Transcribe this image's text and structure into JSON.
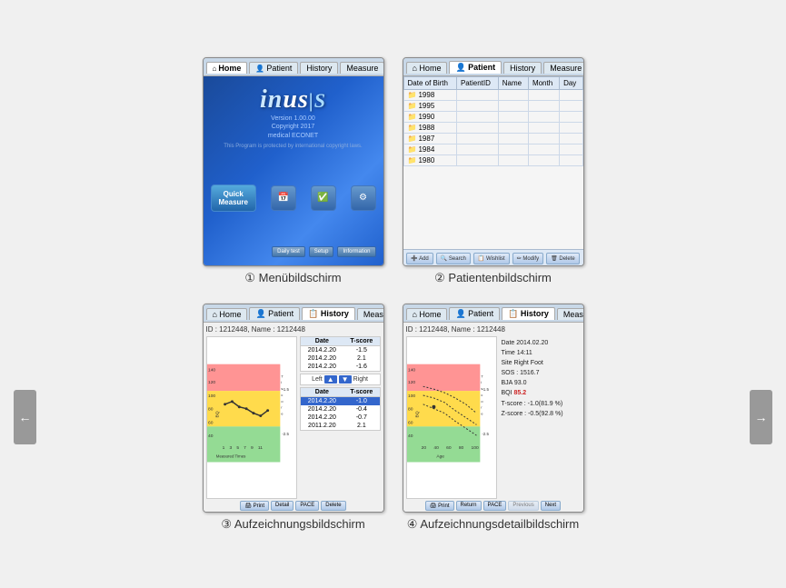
{
  "top_row": {
    "screen1": {
      "tabs": [
        {
          "label": "Home",
          "active": true,
          "icon": "⌂"
        },
        {
          "label": "Patient",
          "active": false,
          "icon": "👤"
        },
        {
          "label": "History",
          "active": false,
          "icon": "📋"
        },
        {
          "label": "Measure",
          "active": false,
          "icon": "📏"
        }
      ],
      "logo": "inus|S",
      "version": "Version 1.00.00",
      "copyright": "Copyright 2017\nmedical ECONET",
      "notice": "This Program is protected by international copyright laws.",
      "quick_measure": "Quick\nMeasure",
      "bottom_buttons": [
        "Daily test",
        "Setup",
        "Information"
      ],
      "caption_num": "①",
      "caption_text": "Menübildschirm"
    },
    "screen2": {
      "tabs": [
        {
          "label": "Home",
          "active": false,
          "icon": "⌂"
        },
        {
          "label": "Patient",
          "active": true,
          "icon": "👤"
        },
        {
          "label": "History",
          "active": false,
          "icon": "📋"
        },
        {
          "label": "Measure",
          "active": false,
          "icon": "📏"
        }
      ],
      "table_headers": [
        "Date of Birth",
        "PatientID",
        "Name",
        "Month",
        "Day"
      ],
      "folders": [
        "1998",
        "1995",
        "1990",
        "1988",
        "1987",
        "1984",
        "1980"
      ],
      "bottom_buttons": [
        "Add",
        "Search",
        "Wishlist",
        "Modify",
        "Delete"
      ],
      "caption_num": "②",
      "caption_text": "Patientenbildschirm"
    }
  },
  "bottom_row": {
    "arrow_left": "←",
    "arrow_right": "→",
    "screen3": {
      "tabs": [
        {
          "label": "Home",
          "active": false,
          "icon": "⌂"
        },
        {
          "label": "Patient",
          "active": false,
          "icon": "👤"
        },
        {
          "label": "History",
          "active": true,
          "icon": "📋"
        },
        {
          "label": "Measure",
          "active": false,
          "icon": "📏"
        }
      ],
      "id_label": "ID : 1212448, Name : 1212448",
      "chart_y_label": "B\nQ",
      "chart_y_values": [
        "140",
        "120",
        "100",
        "80",
        "60",
        "40"
      ],
      "chart_x_label": "Measured Times",
      "chart_x_values": [
        "1",
        "3",
        "5",
        "7",
        "9",
        "11"
      ],
      "t_label": "T\ni\ns\nc\no\nr\ne",
      "t_scale": [
        "-1.5",
        "-2.5"
      ],
      "table_top": {
        "headers": [
          "Date",
          "T-score"
        ],
        "rows": [
          {
            "date": "2014.2.20",
            "score": "-1.5"
          },
          {
            "date": "2014.2.20",
            "score": "2.1"
          },
          {
            "date": "2014.2.20",
            "score": "-1.6"
          }
        ]
      },
      "nav": {
        "left": "Left",
        "right": "Right"
      },
      "table_bottom": {
        "headers": [
          "Date",
          "T-score"
        ],
        "rows": [
          {
            "date": "2014.2.20",
            "score": "-1.0",
            "highlighted": true
          },
          {
            "date": "2014.2.20",
            "score": "-0.4"
          },
          {
            "date": "2014.2.20",
            "score": "-0.7"
          },
          {
            "date": "2011.2.20",
            "score": "2.1"
          }
        ]
      },
      "bottom_buttons": [
        "Print",
        "Detail",
        "PACE",
        "Delete"
      ],
      "caption_num": "③",
      "caption_text": "Aufzeichnungsbildschirm"
    },
    "screen4": {
      "tabs": [
        {
          "label": "Home",
          "active": false,
          "icon": "⌂"
        },
        {
          "label": "Patient",
          "active": false,
          "icon": "👤"
        },
        {
          "label": "History",
          "active": true,
          "icon": "📋"
        },
        {
          "label": "Measure",
          "active": false,
          "icon": "📏"
        }
      ],
      "id_label": "ID : 1212448, Name : 1212448",
      "chart_x_label": "Age",
      "chart_x_values": [
        "20",
        "40",
        "60",
        "80",
        "100"
      ],
      "chart_y_values": [
        "140",
        "120",
        "100",
        "80",
        "60",
        "40"
      ],
      "detail_info": {
        "date": "Date  2014.02.20",
        "time": "Time  14:11",
        "site": "Site  Right Foot",
        "sos": "SOS : 1516.7",
        "bja": "BJA  93.0",
        "bqi": "BQI  85.2",
        "tscore": "T-score : -1.0(81.9 %)",
        "zscore": "Z-score : -0.5(92.8 %)"
      },
      "bottom_buttons": [
        "Print",
        "Return",
        "PACE",
        "Previous",
        "Next"
      ],
      "caption_num": "④",
      "caption_text": "Aufzeichnungsdetailbildschirm"
    }
  }
}
